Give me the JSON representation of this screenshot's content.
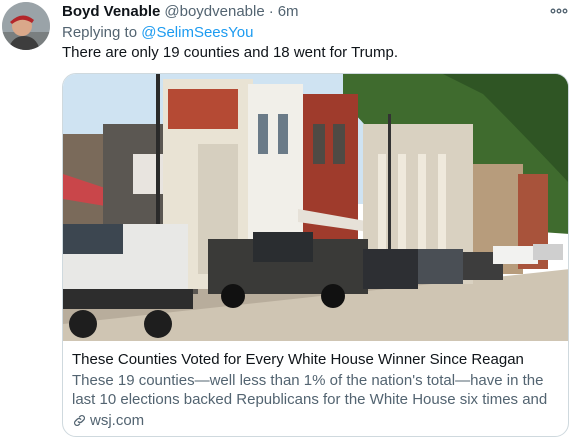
{
  "tweet": {
    "display_name": "Boyd Venable",
    "handle": "@boydvenable",
    "separator": "·",
    "time": "6m",
    "reply_prefix": "Replying to",
    "reply_to": "@SelimSeesYou",
    "text": "There are only 19 counties and 18 went for Trump.",
    "avatar_icon": "user-avatar",
    "more_icon": "more-dots-icon"
  },
  "card": {
    "title": "These Counties Voted for Every White House Winner Since Reagan",
    "description": "These 19 counties—well less than 1% of the nation's total—have in the last 10 elections backed Republicans for the White House six times and …",
    "domain": "wsj.com",
    "domain_icon": "link-icon",
    "image_subject": "small-town main street with parked pickup trucks"
  },
  "colors": {
    "accent": "#1d9bf0",
    "secondary_text": "#536471",
    "border": "#cfd9de"
  }
}
